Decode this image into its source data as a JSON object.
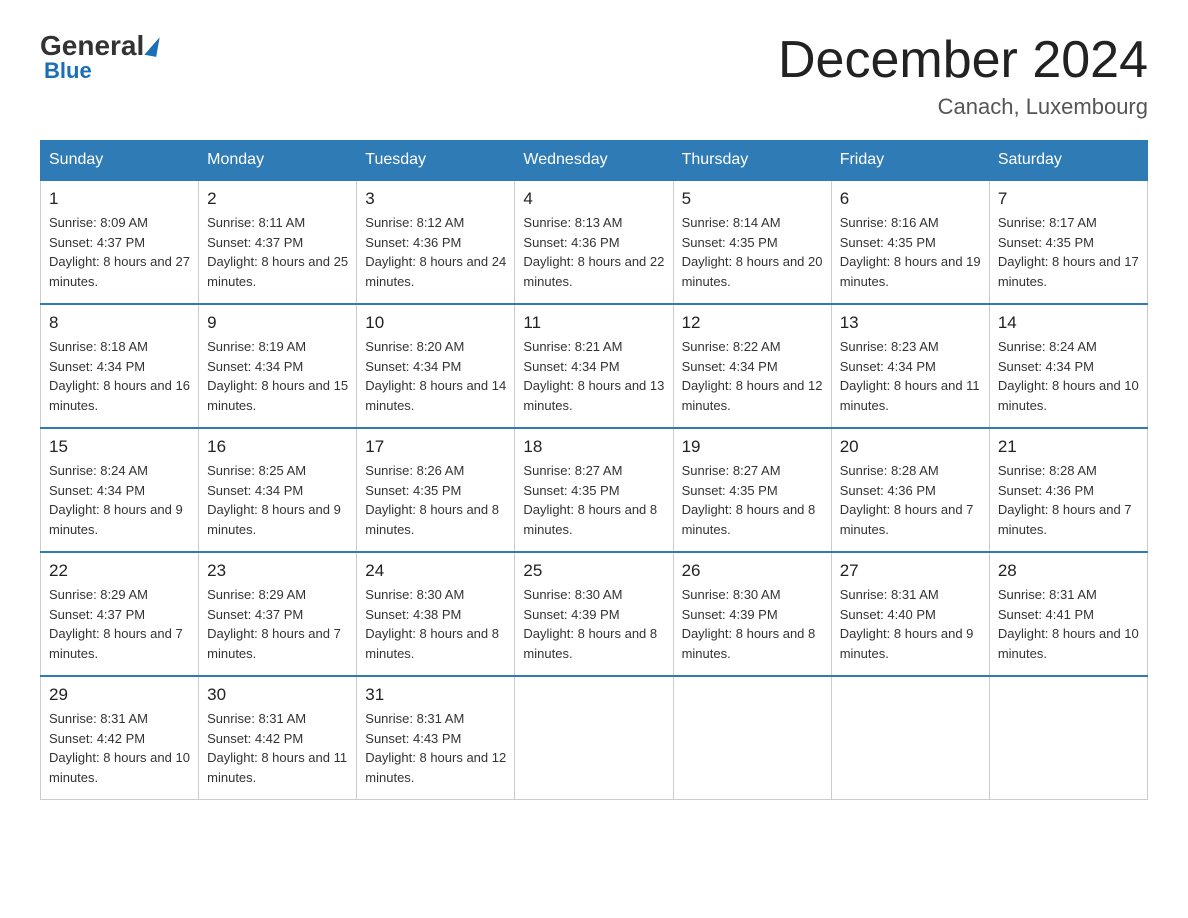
{
  "header": {
    "logo_general": "General",
    "logo_blue": "Blue",
    "month_title": "December 2024",
    "location": "Canach, Luxembourg"
  },
  "days_of_week": [
    "Sunday",
    "Monday",
    "Tuesday",
    "Wednesday",
    "Thursday",
    "Friday",
    "Saturday"
  ],
  "weeks": [
    [
      {
        "day": "1",
        "sunrise": "8:09 AM",
        "sunset": "4:37 PM",
        "daylight": "8 hours and 27 minutes."
      },
      {
        "day": "2",
        "sunrise": "8:11 AM",
        "sunset": "4:37 PM",
        "daylight": "8 hours and 25 minutes."
      },
      {
        "day": "3",
        "sunrise": "8:12 AM",
        "sunset": "4:36 PM",
        "daylight": "8 hours and 24 minutes."
      },
      {
        "day": "4",
        "sunrise": "8:13 AM",
        "sunset": "4:36 PM",
        "daylight": "8 hours and 22 minutes."
      },
      {
        "day": "5",
        "sunrise": "8:14 AM",
        "sunset": "4:35 PM",
        "daylight": "8 hours and 20 minutes."
      },
      {
        "day": "6",
        "sunrise": "8:16 AM",
        "sunset": "4:35 PM",
        "daylight": "8 hours and 19 minutes."
      },
      {
        "day": "7",
        "sunrise": "8:17 AM",
        "sunset": "4:35 PM",
        "daylight": "8 hours and 17 minutes."
      }
    ],
    [
      {
        "day": "8",
        "sunrise": "8:18 AM",
        "sunset": "4:34 PM",
        "daylight": "8 hours and 16 minutes."
      },
      {
        "day": "9",
        "sunrise": "8:19 AM",
        "sunset": "4:34 PM",
        "daylight": "8 hours and 15 minutes."
      },
      {
        "day": "10",
        "sunrise": "8:20 AM",
        "sunset": "4:34 PM",
        "daylight": "8 hours and 14 minutes."
      },
      {
        "day": "11",
        "sunrise": "8:21 AM",
        "sunset": "4:34 PM",
        "daylight": "8 hours and 13 minutes."
      },
      {
        "day": "12",
        "sunrise": "8:22 AM",
        "sunset": "4:34 PM",
        "daylight": "8 hours and 12 minutes."
      },
      {
        "day": "13",
        "sunrise": "8:23 AM",
        "sunset": "4:34 PM",
        "daylight": "8 hours and 11 minutes."
      },
      {
        "day": "14",
        "sunrise": "8:24 AM",
        "sunset": "4:34 PM",
        "daylight": "8 hours and 10 minutes."
      }
    ],
    [
      {
        "day": "15",
        "sunrise": "8:24 AM",
        "sunset": "4:34 PM",
        "daylight": "8 hours and 9 minutes."
      },
      {
        "day": "16",
        "sunrise": "8:25 AM",
        "sunset": "4:34 PM",
        "daylight": "8 hours and 9 minutes."
      },
      {
        "day": "17",
        "sunrise": "8:26 AM",
        "sunset": "4:35 PM",
        "daylight": "8 hours and 8 minutes."
      },
      {
        "day": "18",
        "sunrise": "8:27 AM",
        "sunset": "4:35 PM",
        "daylight": "8 hours and 8 minutes."
      },
      {
        "day": "19",
        "sunrise": "8:27 AM",
        "sunset": "4:35 PM",
        "daylight": "8 hours and 8 minutes."
      },
      {
        "day": "20",
        "sunrise": "8:28 AM",
        "sunset": "4:36 PM",
        "daylight": "8 hours and 7 minutes."
      },
      {
        "day": "21",
        "sunrise": "8:28 AM",
        "sunset": "4:36 PM",
        "daylight": "8 hours and 7 minutes."
      }
    ],
    [
      {
        "day": "22",
        "sunrise": "8:29 AM",
        "sunset": "4:37 PM",
        "daylight": "8 hours and 7 minutes."
      },
      {
        "day": "23",
        "sunrise": "8:29 AM",
        "sunset": "4:37 PM",
        "daylight": "8 hours and 7 minutes."
      },
      {
        "day": "24",
        "sunrise": "8:30 AM",
        "sunset": "4:38 PM",
        "daylight": "8 hours and 8 minutes."
      },
      {
        "day": "25",
        "sunrise": "8:30 AM",
        "sunset": "4:39 PM",
        "daylight": "8 hours and 8 minutes."
      },
      {
        "day": "26",
        "sunrise": "8:30 AM",
        "sunset": "4:39 PM",
        "daylight": "8 hours and 8 minutes."
      },
      {
        "day": "27",
        "sunrise": "8:31 AM",
        "sunset": "4:40 PM",
        "daylight": "8 hours and 9 minutes."
      },
      {
        "day": "28",
        "sunrise": "8:31 AM",
        "sunset": "4:41 PM",
        "daylight": "8 hours and 10 minutes."
      }
    ],
    [
      {
        "day": "29",
        "sunrise": "8:31 AM",
        "sunset": "4:42 PM",
        "daylight": "8 hours and 10 minutes."
      },
      {
        "day": "30",
        "sunrise": "8:31 AM",
        "sunset": "4:42 PM",
        "daylight": "8 hours and 11 minutes."
      },
      {
        "day": "31",
        "sunrise": "8:31 AM",
        "sunset": "4:43 PM",
        "daylight": "8 hours and 12 minutes."
      },
      null,
      null,
      null,
      null
    ]
  ],
  "labels": {
    "sunrise": "Sunrise:",
    "sunset": "Sunset:",
    "daylight": "Daylight:"
  }
}
